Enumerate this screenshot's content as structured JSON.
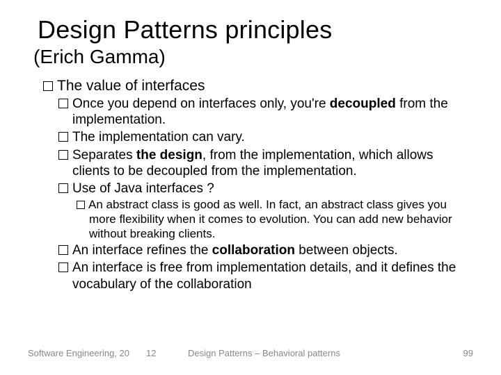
{
  "title": "Design Patterns principles",
  "subtitle": "(Erich Gamma)",
  "lvl1_1": "The value of interfaces",
  "lvl2_1a": "Once you depend on interfaces only, you're ",
  "lvl2_1b": "decoupled",
  "lvl2_1c": " from the implementation.",
  "lvl2_2": "The implementation can vary.",
  "lvl2_3a": "Separates ",
  "lvl2_3b": "the design",
  "lvl2_3c": ", from the implementation, which allows clients to be decoupled from the implementation.",
  "lvl2_4": "Use of Java interfaces ?",
  "lvl3_1": "An abstract class is good as well. In fact, an abstract class gives you more flexibility when it comes to evolution. You can add new behavior without breaking clients.",
  "lvl2_5a": "An interface refines the ",
  "lvl2_5b": "collaboration",
  "lvl2_5c": " between objects.",
  "lvl2_6": "An interface is free from implementation details, and it defines the vocabulary of the collaboration",
  "footer": {
    "left": "Software Engineering, 20",
    "mid": "12",
    "center": "Design Patterns – Behavioral patterns",
    "right": "99"
  }
}
